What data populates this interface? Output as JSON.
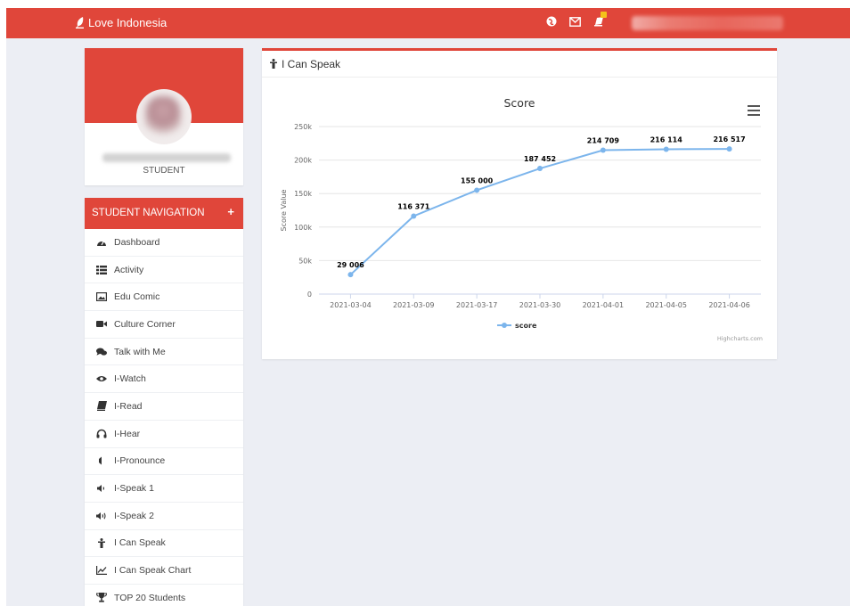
{
  "topbar": {
    "brand": "Love Indonesia",
    "icons": [
      "globe-icon",
      "envelope-icon",
      "notification-icon"
    ],
    "colors": {
      "primary": "#e0463a",
      "badge": "#f4c21a"
    }
  },
  "profile": {
    "role": "STUDENT"
  },
  "nav": {
    "title": "STUDENT NAVIGATION",
    "toggle": "+",
    "items": [
      {
        "label": "Dashboard",
        "icon": "dashboard-icon"
      },
      {
        "label": "Activity",
        "icon": "list-icon"
      },
      {
        "label": "Edu Comic",
        "icon": "image-icon"
      },
      {
        "label": "Culture Corner",
        "icon": "video-camera-icon"
      },
      {
        "label": "Talk with Me",
        "icon": "chat-icon"
      },
      {
        "label": "I-Watch",
        "icon": "eye-icon"
      },
      {
        "label": "I-Read",
        "icon": "book-icon"
      },
      {
        "label": "I-Hear",
        "icon": "headphones-icon"
      },
      {
        "label": "I-Pronounce",
        "icon": "speaker-off-icon"
      },
      {
        "label": "I-Speak 1",
        "icon": "speaker-low-icon"
      },
      {
        "label": "I-Speak 2",
        "icon": "speaker-high-icon"
      },
      {
        "label": "I Can Speak",
        "icon": "person-icon"
      },
      {
        "label": "I Can Speak Chart",
        "icon": "line-chart-icon"
      },
      {
        "label": "TOP 20 Students",
        "icon": "trophy-icon"
      }
    ]
  },
  "panel": {
    "title": "I Can Speak",
    "icon": "person-icon"
  },
  "chart_data": {
    "type": "line",
    "title": "Score",
    "xlabel": "",
    "ylabel": "Score Value",
    "categories": [
      "2021-03-04",
      "2021-03-09",
      "2021-03-17",
      "2021-03-30",
      "2021-04-01",
      "2021-04-05",
      "2021-04-06"
    ],
    "series": [
      {
        "name": "score",
        "values": [
          29006,
          116371,
          155000,
          187452,
          214709,
          216114,
          216517
        ],
        "color": "#7cb5ec"
      }
    ],
    "data_labels": [
      "29 006",
      "116 371",
      "155 000",
      "187 452",
      "214 709",
      "216 114",
      "216 517"
    ],
    "ylim": [
      0,
      250000
    ],
    "yticks": [
      0,
      50000,
      100000,
      150000,
      200000,
      250000
    ],
    "ytick_labels": [
      "0",
      "50k",
      "100k",
      "150k",
      "200k",
      "250k"
    ],
    "grid": true,
    "legend": "bottom-center",
    "credits": "Highcharts.com"
  }
}
